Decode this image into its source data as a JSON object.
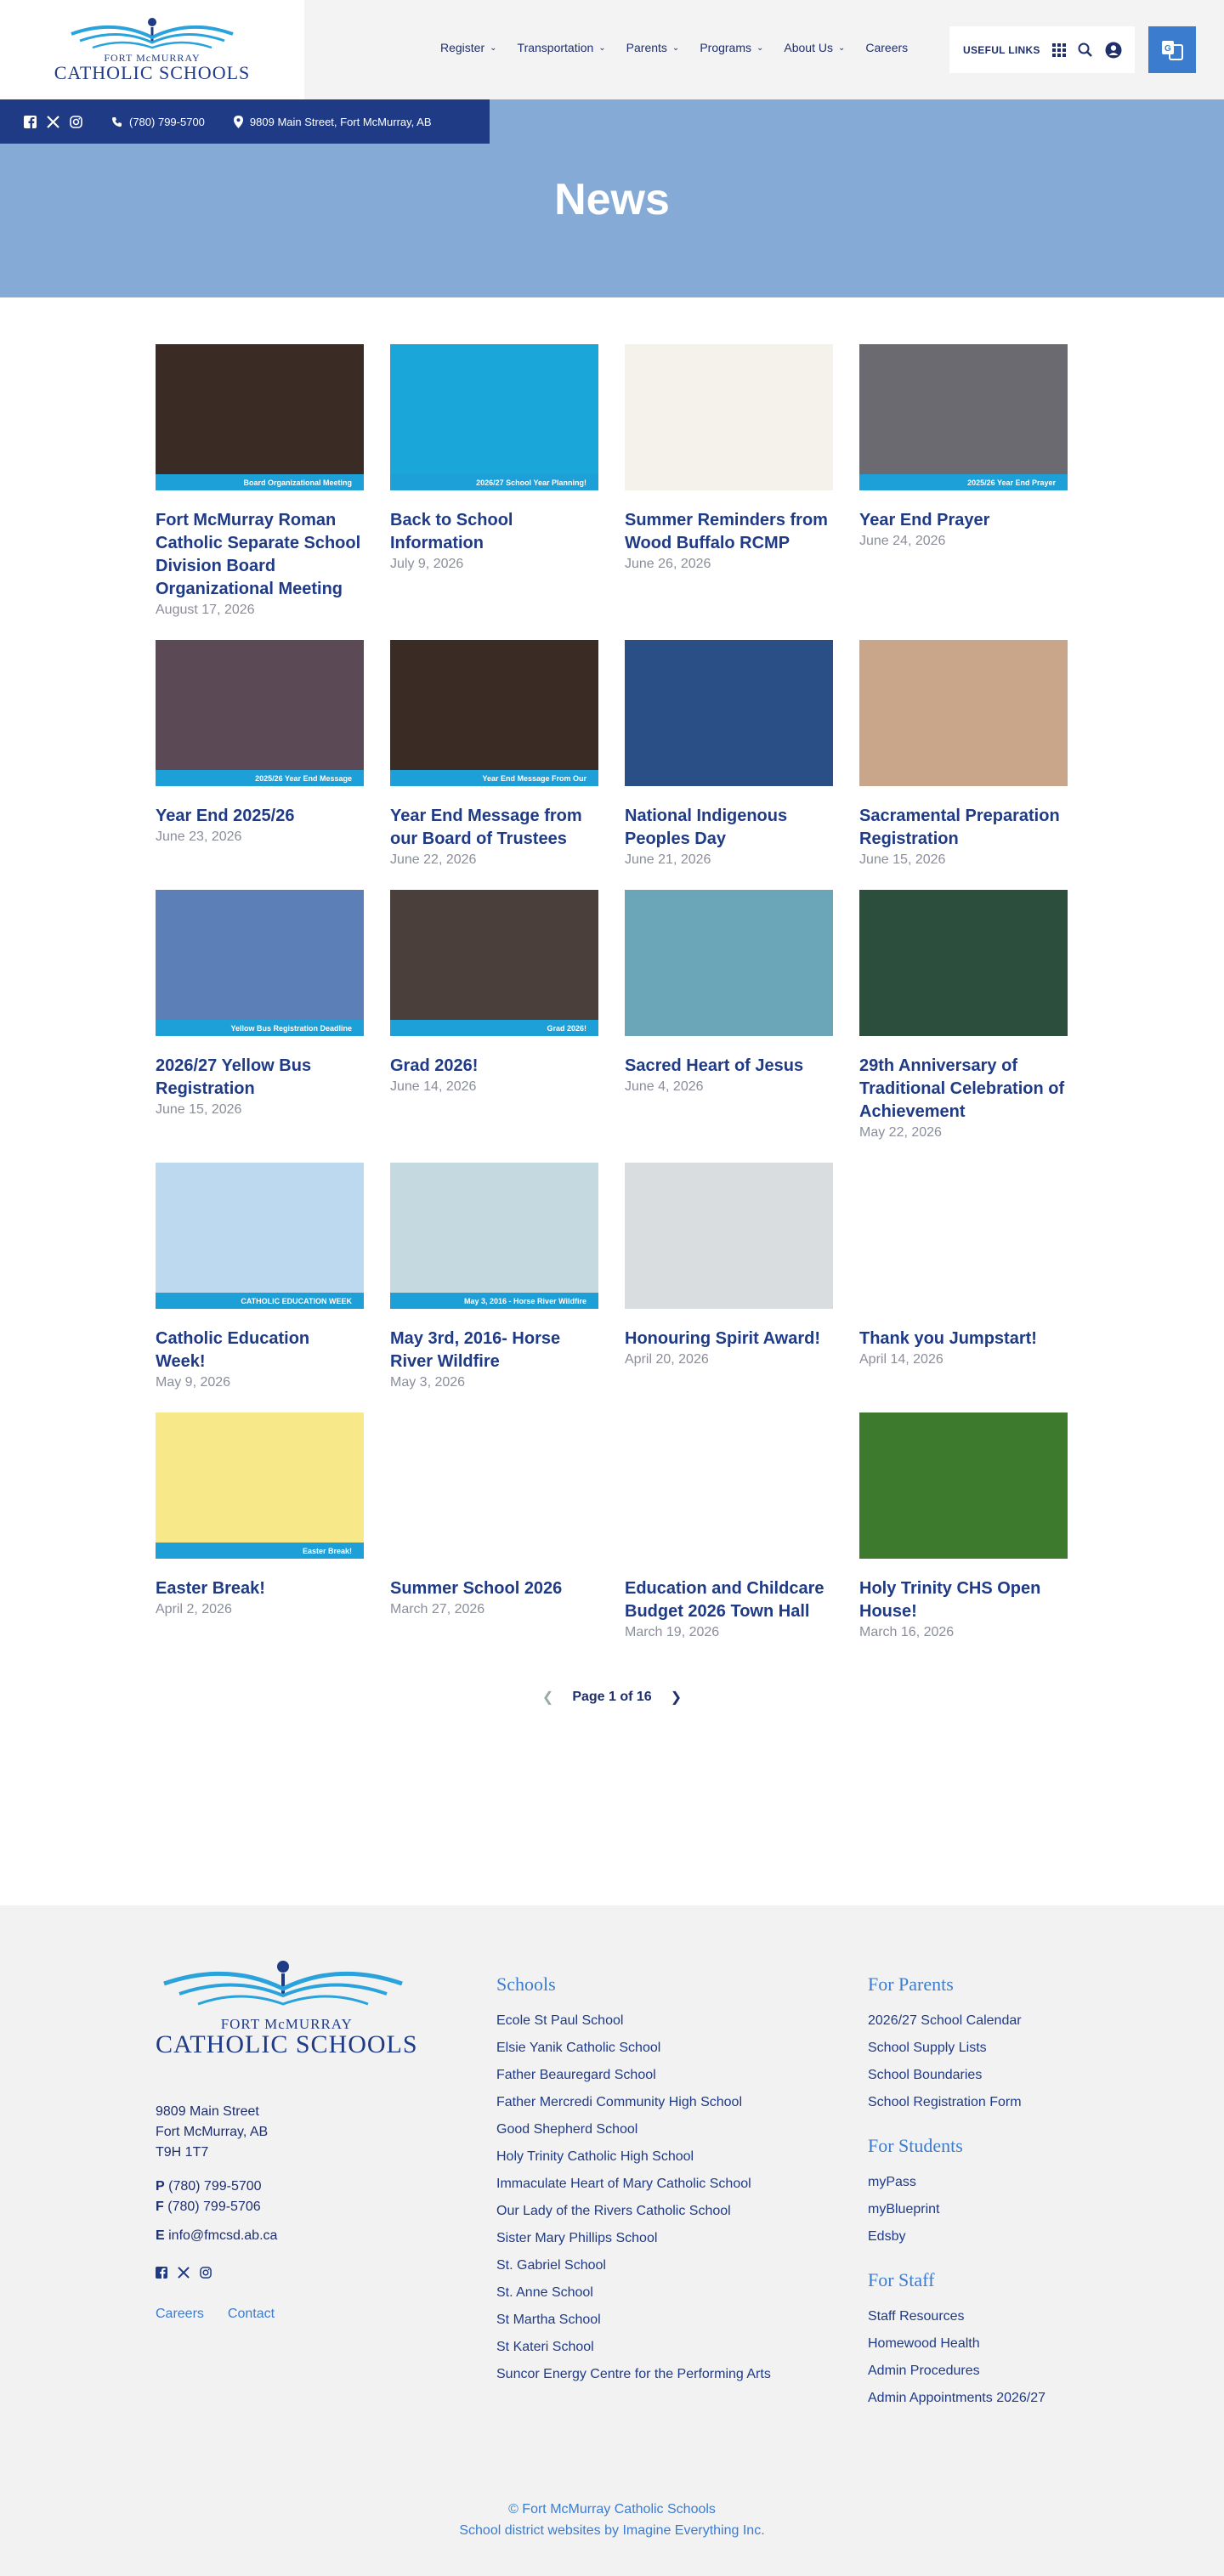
{
  "brand": {
    "line1": "FORT McMURRAY",
    "line2": "CATHOLIC SCHOOLS"
  },
  "nav": {
    "items": [
      "Register",
      "Transportation",
      "Parents",
      "Programs",
      "About Us"
    ],
    "careers": "Careers",
    "useful_links": "USEFUL LINKS"
  },
  "contact_bar": {
    "phone": "(780) 799-5700",
    "address": "9809 Main Street, Fort McMurray, AB"
  },
  "page": {
    "title": "News"
  },
  "news": [
    {
      "title": "Fort McMurray Roman Catholic Separate School Division Board Organizational Meeting",
      "date": "August 17, 2026",
      "caption": "Board Organizational Meeting",
      "bg": "#3a2c24"
    },
    {
      "title": "Back to School Information",
      "date": "July 9, 2026",
      "caption": "2026/27 School Year Planning!",
      "bg": "#1aa6d8"
    },
    {
      "title": "Summer Reminders from Wood Buffalo RCMP",
      "date": "June 26, 2026",
      "caption": "",
      "bg": "#f4f2ea"
    },
    {
      "title": "Year End Prayer",
      "date": "June 24, 2026",
      "caption": "2025/26 Year End Prayer",
      "bg": "#6a6a70"
    },
    {
      "title": "Year End 2025/26",
      "date": "June 23, 2026",
      "caption": "2025/26 Year End Message",
      "bg": "#5b4a55"
    },
    {
      "title": "Year End Message from our Board of Trustees",
      "date": "June 22, 2026",
      "caption": "Year End Message From Our",
      "bg": "#3a2c24"
    },
    {
      "title": "National Indigenous Peoples Day",
      "date": "June 21, 2026",
      "caption": "",
      "bg": "#2a4f86"
    },
    {
      "title": "Sacramental Preparation Registration",
      "date": "June 15, 2026",
      "caption": "",
      "bg": "#c9a58a"
    },
    {
      "title": "2026/27 Yellow Bus Registration",
      "date": "June 15, 2026",
      "caption": "Yellow Bus Registration Deadline",
      "bg": "#5d7fb8"
    },
    {
      "title": "Grad 2026!",
      "date": "June 14, 2026",
      "caption": "Grad 2026!",
      "bg": "#4a3f3a"
    },
    {
      "title": "Sacred Heart of Jesus",
      "date": "June 4, 2026",
      "caption": "",
      "bg": "#6aa6b8"
    },
    {
      "title": "29th Anniversary of Traditional Celebration of Achievement",
      "date": "May 22, 2026",
      "caption": "",
      "bg": "#2b4f3c"
    },
    {
      "title": "Catholic Education Week!",
      "date": "May 9, 2026",
      "caption": "CATHOLIC EDUCATION WEEK",
      "bg": "#bcd9f0"
    },
    {
      "title": "May 3rd, 2016- Horse River Wildfire",
      "date": "May 3, 2026",
      "caption": "May 3, 2016 - Horse River Wildfire",
      "bg": "#c5d9e0"
    },
    {
      "title": "Honouring Spirit Award!",
      "date": "April 20, 2026",
      "caption": "",
      "bg": "#d9dde0"
    },
    {
      "title": "Thank you Jumpstart!",
      "date": "April 14, 2026",
      "caption": "",
      "bg": "#ffffff"
    },
    {
      "title": "Easter Break!",
      "date": "April 2, 2026",
      "caption": "Easter Break!",
      "bg": "#f7e98a"
    },
    {
      "title": "Summer School 2026",
      "date": "March 27, 2026",
      "caption": "",
      "bg": "#ffffff"
    },
    {
      "title": "Education and Childcare Budget 2026 Town Hall",
      "date": "March 19, 2026",
      "caption": "",
      "bg": "#ffffff"
    },
    {
      "title": "Holy Trinity CHS Open House!",
      "date": "March 16, 2026",
      "caption": "",
      "bg": "#3e7a2e"
    }
  ],
  "pagination": {
    "label": "Page 1 of 16"
  },
  "footer": {
    "address": [
      "9809 Main Street",
      "Fort McMurray, AB",
      "T9H 1T7"
    ],
    "phone_label": "P",
    "phone": "(780) 799-5700",
    "fax_label": "F",
    "fax": "(780) 799-5706",
    "email_label": "E",
    "email": "info@fmcsd.ab.ca",
    "links": [
      "Careers",
      "Contact"
    ],
    "schools_heading": "Schools",
    "schools": [
      "Ecole St Paul School",
      "Elsie Yanik Catholic School",
      "Father Beauregard School",
      "Father Mercredi Community High School",
      "Good Shepherd School",
      "Holy Trinity Catholic High School",
      "Immaculate Heart of Mary Catholic School",
      "Our Lady of the Rivers Catholic School",
      "Sister Mary Phillips School",
      "St. Gabriel School",
      "St. Anne School",
      "St Martha School",
      "St Kateri School",
      "Suncor Energy Centre for the Performing Arts"
    ],
    "parents_heading": "For Parents",
    "parents": [
      "2026/27 School Calendar",
      "School Supply Lists",
      "School Boundaries",
      "School Registration Form"
    ],
    "students_heading": "For Students",
    "students": [
      "myPass",
      "myBlueprint",
      "Edsby"
    ],
    "staff_heading": "For Staff",
    "staff": [
      "Staff Resources",
      "Homewood Health",
      "Admin Procedures",
      "Admin Appointments 2026/27"
    ],
    "copyright": "© Fort McMurray Catholic Schools",
    "credit": "School district websites by Imagine Everything Inc."
  }
}
